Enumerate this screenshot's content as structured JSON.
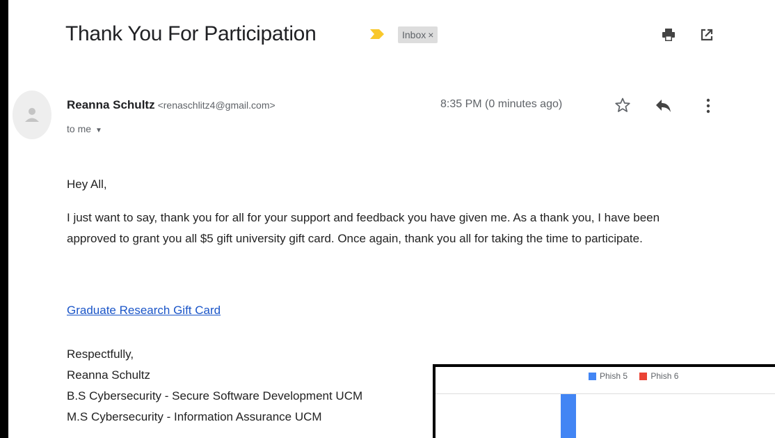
{
  "email": {
    "subject": "Thank You For Participation",
    "label": "Inbox",
    "label_close": "×",
    "sender_name": "Reanna Schultz",
    "sender_email": "<renaschlitz4@gmail.com>",
    "recipient": "to me",
    "time": "8:35 PM (0 minutes ago)",
    "greeting": "Hey All,",
    "body": "I just want to say, thank you for all for your support and feedback you have given me. As a thank you, I have been approved to grant you all $5 gift university gift card. Once again, thank you all for taking the time to participate.",
    "link_text": "Graduate Research Gift Card",
    "signature": [
      "Respectfully,",
      "Reanna Schultz",
      "B.S Cybersecurity - Secure Software Development UCM",
      "M.S Cybersecurity - Information Assurance UCM"
    ]
  },
  "icons": {
    "important": "important-marker-icon",
    "print": "print-icon",
    "open_new": "open-in-new-window-icon",
    "avatar": "avatar-placeholder-icon",
    "star": "star-icon",
    "reply": "reply-icon",
    "more": "more-vertical-icon",
    "caret": "chevron-down-icon"
  },
  "colors": {
    "important": "#f9c82b",
    "link": "#1a55c8",
    "phish5": "#4285f4",
    "phish6": "#ea4335"
  },
  "chart_data": {
    "type": "bar",
    "series": [
      {
        "name": "Phish 5",
        "values": []
      },
      {
        "name": "Phish 6",
        "values": []
      }
    ],
    "legend": "top"
  }
}
